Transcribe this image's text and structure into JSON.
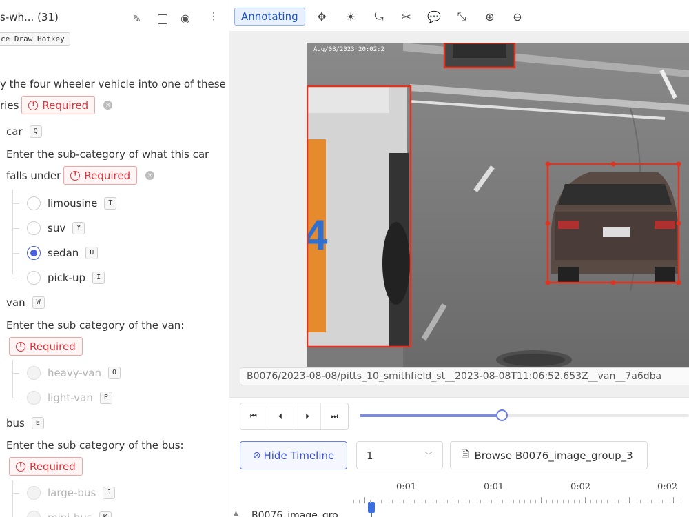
{
  "panel": {
    "title": "s-wh... (31)",
    "hotkey_badge": "ce Draw Hotkey",
    "question1": {
      "line1": "y the four wheeler vehicle into one of these",
      "line2": "ries",
      "required": "Required"
    },
    "car": {
      "label": "car",
      "key": "Q",
      "sub_q_line1": "Enter the sub-category of what this car",
      "sub_q_line2": "falls under",
      "required": "Required",
      "options": [
        {
          "label": "limousine",
          "key": "T"
        },
        {
          "label": "suv",
          "key": "Y"
        },
        {
          "label": "sedan",
          "key": "U"
        },
        {
          "label": "pick-up",
          "key": "I"
        }
      ]
    },
    "van": {
      "label": "van",
      "key": "W",
      "sub_q": "Enter the sub category of the van:",
      "required": "Required",
      "options": [
        {
          "label": "heavy-van",
          "key": "O"
        },
        {
          "label": "light-van",
          "key": "P"
        }
      ]
    },
    "bus": {
      "label": "bus",
      "key": "E",
      "sub_q": "Enter the sub category of the bus:",
      "required": "Required",
      "options": [
        {
          "label": "large-bus",
          "key": "J"
        },
        {
          "label": "mini-bus",
          "key": "K"
        }
      ]
    }
  },
  "toolbar": {
    "mode": "Annotating"
  },
  "image": {
    "timestamp": "Aug/08/2023 20:02:2",
    "path": "B0076/2023-08-08/pitts_10_smithfield_st__2023-08-08T11:06:52.653Z__van__7a6dba"
  },
  "player": {
    "progress": 0.43
  },
  "controls": {
    "hide_timeline": "Hide Timeline",
    "frame_value": "1",
    "browse": "Browse B0076_image_group_3"
  },
  "timeline": {
    "labels": [
      "0:01",
      "0:01",
      "0:02",
      "0:02"
    ],
    "track": "B0076_image_gro"
  },
  "colors": {
    "accent": "#4a5fdc",
    "required": "#d9363e",
    "bbox": "#e0321e"
  }
}
